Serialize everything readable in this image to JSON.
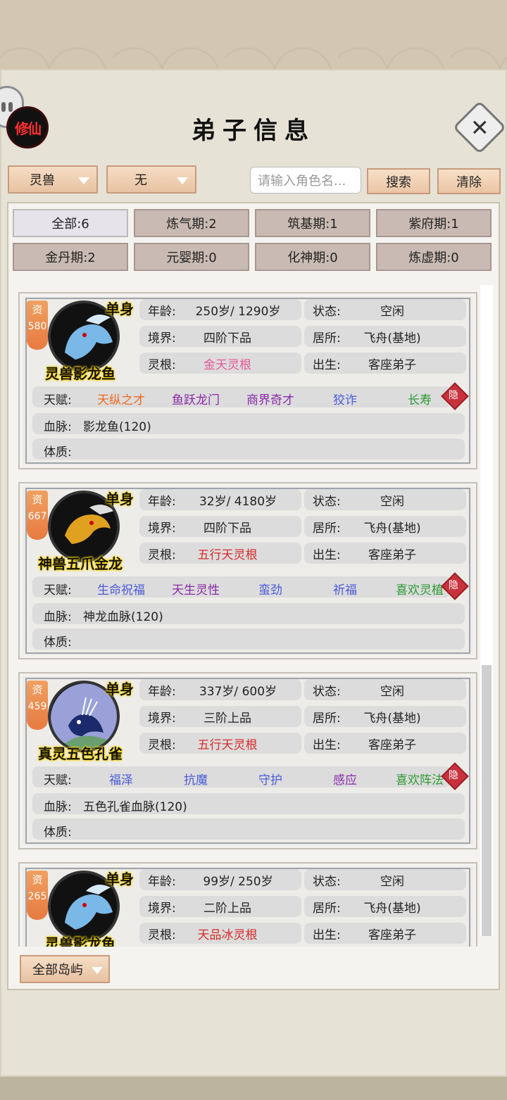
{
  "header": {
    "logo_text": "修仙",
    "title": "弟子信息"
  },
  "toolbar": {
    "type_select": "灵兽",
    "sub_select": "无",
    "search_placeholder": "请输入角色名...",
    "search_label": "搜索",
    "clear_label": "清除"
  },
  "filters": [
    {
      "label": "全部:6",
      "active": true
    },
    {
      "label": "炼气期:2"
    },
    {
      "label": "筑基期:1"
    },
    {
      "label": "紫府期:1"
    },
    {
      "label": "金丹期:2"
    },
    {
      "label": "元婴期:0"
    },
    {
      "label": "化神期:0"
    },
    {
      "label": "炼虚期:0"
    }
  ],
  "labels": {
    "age": "年龄:",
    "state": "状态:",
    "realm": "境界:",
    "residence": "居所:",
    "root": "灵根:",
    "birth": "出生:",
    "talent": "天赋:",
    "blood": "血脉:",
    "physique": "体质:",
    "zi": "资",
    "single": "单身",
    "hide": "隐"
  },
  "cards": [
    {
      "zi_value": "580",
      "name": "灵兽影龙鱼",
      "age": "250岁/ 1290岁",
      "state": "空闲",
      "realm": "四阶下品",
      "residence": "飞舟(基地)",
      "root": "金天灵根",
      "root_color": "#e8589a",
      "birth": "客座弟子",
      "talents": [
        {
          "text": "天纵之才",
          "color": "#ee6a22"
        },
        {
          "text": "鱼跃龙门",
          "color": "#8a2aa8"
        },
        {
          "text": "商界奇才",
          "color": "#8a2aa8"
        },
        {
          "text": "狡诈",
          "color": "#4a5bd8"
        },
        {
          "text": "长寿",
          "color": "#2e9a34"
        }
      ],
      "blood": "影龙鱼(120)",
      "physique": "",
      "avatar_icon": "blue-dragon-fish"
    },
    {
      "zi_value": "667",
      "name": "神兽五爪金龙",
      "age": "32岁/ 4180岁",
      "state": "空闲",
      "realm": "四阶下品",
      "residence": "飞舟(基地)",
      "root": "五行天灵根",
      "root_color": "#d82a2a",
      "birth": "客座弟子",
      "talents": [
        {
          "text": "生命祝福",
          "color": "#4a5bd8"
        },
        {
          "text": "天生灵性",
          "color": "#8a2aa8"
        },
        {
          "text": "蛮劲",
          "color": "#4a5bd8"
        },
        {
          "text": "祈福",
          "color": "#4a5bd8"
        },
        {
          "text": "喜欢灵植",
          "color": "#2e9a34"
        }
      ],
      "blood": "神龙血脉(120)",
      "physique": "",
      "avatar_icon": "golden-dragon"
    },
    {
      "zi_value": "459",
      "name": "真灵五色孔雀",
      "age": "337岁/ 600岁",
      "state": "空闲",
      "realm": "三阶上品",
      "residence": "飞舟(基地)",
      "root": "五行天灵根",
      "root_color": "#d82a2a",
      "birth": "客座弟子",
      "talents": [
        {
          "text": "福泽",
          "color": "#4a5bd8"
        },
        {
          "text": "抗魔",
          "color": "#4a5bd8"
        },
        {
          "text": "守护",
          "color": "#4a5bd8"
        },
        {
          "text": "感应",
          "color": "#8a2aa8"
        },
        {
          "text": "喜欢阵法",
          "color": "#2e9a34"
        }
      ],
      "blood": "五色孔雀血脉(120)",
      "physique": "",
      "avatar_icon": "peacock"
    },
    {
      "zi_value": "265",
      "name": "灵兽影龙鱼",
      "age": "99岁/ 250岁",
      "state": "空闲",
      "realm": "二阶上品",
      "residence": "飞舟(基地)",
      "root": "天品冰灵根",
      "root_color": "#d82a2a",
      "birth": "客座弟子",
      "talents": [],
      "blood": "",
      "physique": "",
      "avatar_icon": "blue-dragon-fish"
    }
  ],
  "footer": {
    "island_select": "全部岛屿"
  }
}
